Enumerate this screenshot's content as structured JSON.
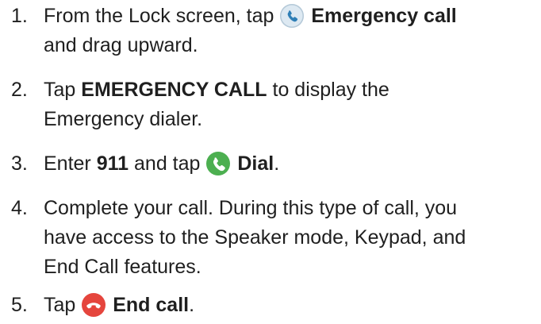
{
  "steps": [
    {
      "number": "1.",
      "line1_prefix": "From the Lock screen, tap",
      "line1_bold": "Emergency call",
      "line2": "and drag upward.",
      "icon": "phone-icon"
    },
    {
      "number": "2.",
      "line1_prefix": "Tap",
      "line1_bold": "EMERGENCY CALL",
      "line1_suffix": "to display the",
      "line2": "Emergency dialer."
    },
    {
      "number": "3.",
      "prefix": "Enter",
      "bold_number": "911",
      "middle": "and tap",
      "bold_label": "Dial",
      "suffix": ".",
      "icon": "phone-icon"
    },
    {
      "number": "4.",
      "line1": "Complete your call. During this type of call, you",
      "line2": "have access to the Speaker mode, Keypad, and",
      "line3": "End Call features."
    },
    {
      "number": "5.",
      "prefix": "Tap",
      "bold_label": "End call",
      "suffix": ".",
      "icon": "end-call-icon"
    }
  ],
  "colors": {
    "text": "#1f1f1f",
    "emergency_icon_bg": "#dde9f2",
    "emergency_icon_glyph": "#2f7fb6",
    "dial_icon_bg": "#4caf50",
    "end_call_icon_bg": "#e5453d"
  }
}
